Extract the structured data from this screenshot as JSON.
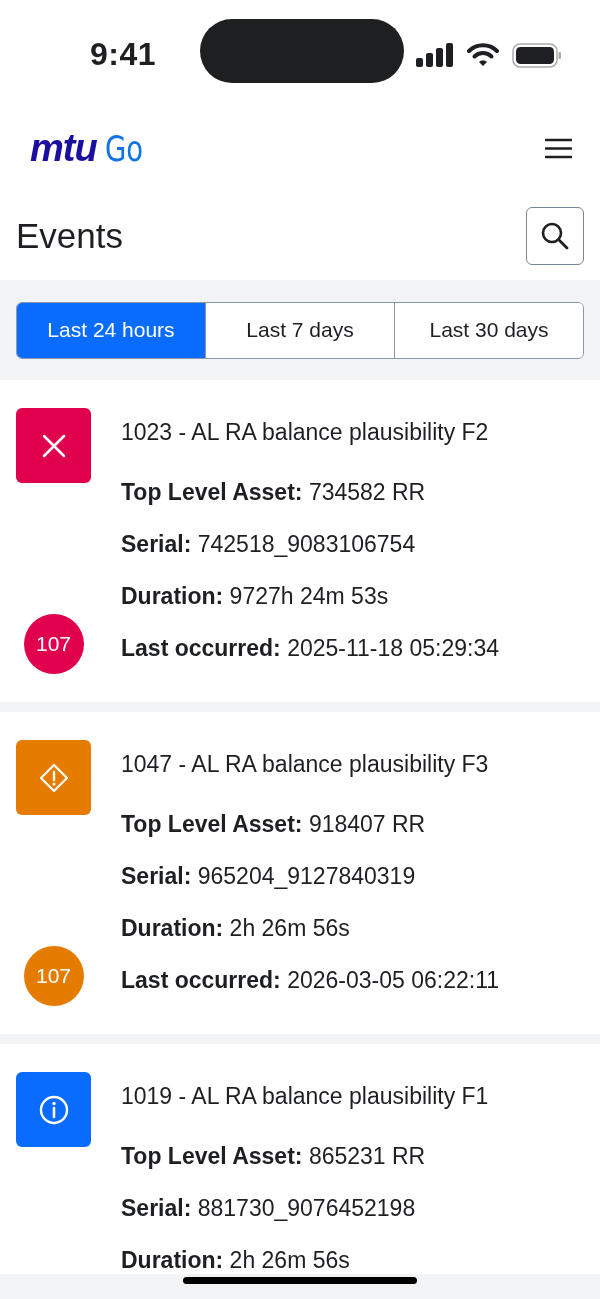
{
  "status_bar": {
    "time": "9:41"
  },
  "header": {
    "logo": {
      "brand": "mtu",
      "product": "Go"
    }
  },
  "page": {
    "title": "Events"
  },
  "tabs": [
    {
      "label": "Last 24 hours",
      "selected": true
    },
    {
      "label": "Last 7 days",
      "selected": false
    },
    {
      "label": "Last 30 days",
      "selected": false
    }
  ],
  "events": [
    {
      "kind": "error",
      "color": "#e0004d",
      "title": "1023 - AL RA balance plausibility F2",
      "badge": "107",
      "fields": [
        {
          "label": "Top Level Asset:",
          "value": "734582 RR"
        },
        {
          "label": "Serial:",
          "value": "742518_9083106754"
        },
        {
          "label": "Duration:",
          "value": "9727h 24m 53s"
        },
        {
          "label": "Last occurred:",
          "value": "2025-11-18 05:29:34"
        }
      ]
    },
    {
      "kind": "warning",
      "color": "#e57c00",
      "title": "1047 - AL RA balance plausibility F3",
      "badge": "107",
      "fields": [
        {
          "label": "Top Level Asset:",
          "value": "918407 RR"
        },
        {
          "label": "Serial:",
          "value": "965204_9127840319"
        },
        {
          "label": "Duration:",
          "value": "2h 26m 56s"
        },
        {
          "label": "Last occurred:",
          "value": "2026-03-05 06:22:11"
        }
      ]
    },
    {
      "kind": "info",
      "color": "#0a6cff",
      "title": "1019 - AL RA balance plausibility F1",
      "fields": [
        {
          "label": "Top Level Asset:",
          "value": "865231 RR"
        },
        {
          "label": "Serial:",
          "value": "881730_9076452198"
        },
        {
          "label": "Duration:",
          "value": "2h 26m 56s"
        }
      ]
    }
  ]
}
